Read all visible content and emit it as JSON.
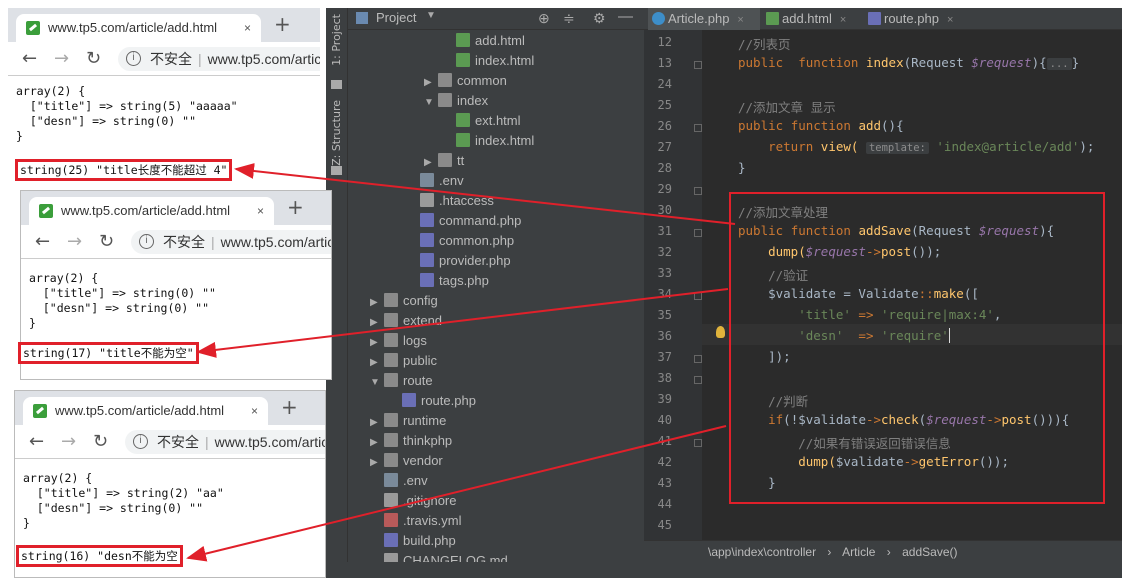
{
  "browser1": {
    "tab_title": "www.tp5.com/article/add.html",
    "close": "×",
    "new_tab": "+",
    "insecure": "不安全",
    "separator": "|",
    "url": "www.tp5.com/article/add.html",
    "dump": "array(2) {\n  [\"title\"] => string(5) \"aaaaa\"\n  [\"desn\"] => string(0) \"\"\n}",
    "error": "string(25) \"title长度不能超过 4\""
  },
  "browser2": {
    "tab_title": "www.tp5.com/article/add.html",
    "close": "×",
    "new_tab": "+",
    "insecure": "不安全",
    "separator": "|",
    "url": "www.tp5.com/article/add.html",
    "dump": "array(2) {\n  [\"title\"] => string(0) \"\"\n  [\"desn\"] => string(0) \"\"\n}",
    "error": "string(17) \"title不能为空\""
  },
  "browser3": {
    "tab_title": "www.tp5.com/article/add.html",
    "close": "×",
    "new_tab": "+",
    "insecure": "不安全",
    "separator": "|",
    "url": "www.tp5.com/article/add.html",
    "dump": "array(2) {\n  [\"title\"] => string(2) \"aa\"\n  [\"desn\"] => string(0) \"\"\n}",
    "error": "string(16) \"desn不能为空"
  },
  "ide": {
    "side_labels": [
      "1: Project",
      "Z: Structure"
    ],
    "project_title": "Project",
    "project_tree": [
      {
        "label": "add.html",
        "icon": "html",
        "depth": 5,
        "arrow": ""
      },
      {
        "label": "index.html",
        "icon": "html",
        "depth": 5,
        "arrow": ""
      },
      {
        "label": "common",
        "icon": "folder",
        "depth": 4,
        "arrow": "▶"
      },
      {
        "label": "index",
        "icon": "folder",
        "depth": 4,
        "arrow": "▼"
      },
      {
        "label": "ext.html",
        "icon": "html",
        "depth": 5,
        "arrow": ""
      },
      {
        "label": "index.html",
        "icon": "html",
        "depth": 5,
        "arrow": ""
      },
      {
        "label": "tt",
        "icon": "folder",
        "depth": 4,
        "arrow": "▶"
      },
      {
        "label": ".env",
        "icon": "env",
        "depth": 3,
        "arrow": ""
      },
      {
        "label": ".htaccess",
        "icon": "file",
        "depth": 3,
        "arrow": ""
      },
      {
        "label": "command.php",
        "icon": "php",
        "depth": 3,
        "arrow": ""
      },
      {
        "label": "common.php",
        "icon": "php",
        "depth": 3,
        "arrow": ""
      },
      {
        "label": "provider.php",
        "icon": "php",
        "depth": 3,
        "arrow": ""
      },
      {
        "label": "tags.php",
        "icon": "php",
        "depth": 3,
        "arrow": ""
      },
      {
        "label": "config",
        "icon": "folder",
        "depth": 1,
        "arrow": "▶"
      },
      {
        "label": "extend",
        "icon": "folder",
        "depth": 1,
        "arrow": "▶"
      },
      {
        "label": "logs",
        "icon": "folder",
        "depth": 1,
        "arrow": "▶"
      },
      {
        "label": "public",
        "icon": "folder",
        "depth": 1,
        "arrow": "▶"
      },
      {
        "label": "route",
        "icon": "folder",
        "depth": 1,
        "arrow": "▼"
      },
      {
        "label": "route.php",
        "icon": "php",
        "depth": 2,
        "arrow": ""
      },
      {
        "label": "runtime",
        "icon": "folder",
        "depth": 1,
        "arrow": "▶"
      },
      {
        "label": "thinkphp",
        "icon": "folder",
        "depth": 1,
        "arrow": "▶"
      },
      {
        "label": "vendor",
        "icon": "folder",
        "depth": 1,
        "arrow": "▶"
      },
      {
        "label": ".env",
        "icon": "env",
        "depth": 1,
        "arrow": ""
      },
      {
        "label": ".gitignore",
        "icon": "file",
        "depth": 1,
        "arrow": ""
      },
      {
        "label": ".travis.yml",
        "icon": "yml",
        "depth": 1,
        "arrow": ""
      },
      {
        "label": "build.php",
        "icon": "php",
        "depth": 1,
        "arrow": ""
      },
      {
        "label": "CHANGELOG.md",
        "icon": "file",
        "depth": 1,
        "arrow": ""
      }
    ],
    "tabs": [
      {
        "label": "Article.php",
        "close": "×"
      },
      {
        "label": "add.html",
        "close": "×"
      },
      {
        "label": "route.php",
        "close": "×"
      }
    ],
    "line_numbers": [
      "12",
      "13",
      "24",
      "25",
      "26",
      "27",
      "28",
      "29",
      "30",
      "31",
      "32",
      "33",
      "34",
      "35",
      "36",
      "37",
      "38",
      "39",
      "40",
      "41",
      "42",
      "43",
      "44",
      "45"
    ],
    "code": {
      "l12": "//列表页",
      "l13_kw1": "public",
      "l13_kw2": "function",
      "l13_fn": "index",
      "l13_arg": "(Request ",
      "l13_var": "$request",
      "l13_end": "){",
      "l13_fold": "...",
      "l13_close": "}",
      "l25": "//添加文章 显示",
      "l26_kw1": "public",
      "l26_kw2": "function",
      "l26_fn": "add",
      "l26_end": "(){",
      "l27_kw": "return",
      "l27_fn": "view(",
      "l27_hint": "template:",
      "l27_str": "'index@article/add'",
      "l27_end": ");",
      "l28": "}",
      "l30": "//添加文章处理",
      "l31_kw1": "public",
      "l31_kw2": "function",
      "l31_fn": "addSave",
      "l31_arg": "(Request ",
      "l31_var": "$request",
      "l31_end": "){",
      "l32_fn": "dump(",
      "l32_var": "$request",
      "l32_arrow": "->",
      "l32_m": "post",
      "l32_end": "());",
      "l33": "//验证",
      "l34_var": "$validate",
      "l34_eq": " = Validate",
      "l34_op": "::",
      "l34_m": "make",
      "l34_end": "([",
      "l35_key": "'title'",
      "l35_arrow": " => ",
      "l35_val": "'require|max:4'",
      "l35_end": ",",
      "l36_key": "'desn'",
      "l36_arrow": "  => ",
      "l36_val": "'require'",
      "l37": "]);",
      "l39": "//判断",
      "l40_kw": "if",
      "l40_a": "(!",
      "l40_var": "$validate",
      "l40_arrow": "->",
      "l40_m": "check",
      "l40_b": "(",
      "l40_var2": "$request",
      "l40_arrow2": "->",
      "l40_m2": "post",
      "l40_end": "())){",
      "l41": "//如果有错误返回错误信息",
      "l42_fn": "dump(",
      "l42_var": "$validate",
      "l42_arrow": "->",
      "l42_m": "getError",
      "l42_end": "());",
      "l43": "}"
    },
    "breadcrumb": [
      "\\app\\index\\controller",
      "Article",
      "addSave()"
    ],
    "breadcrumb_sep": "›"
  },
  "colors": {
    "accent_red": "#e0202a"
  }
}
